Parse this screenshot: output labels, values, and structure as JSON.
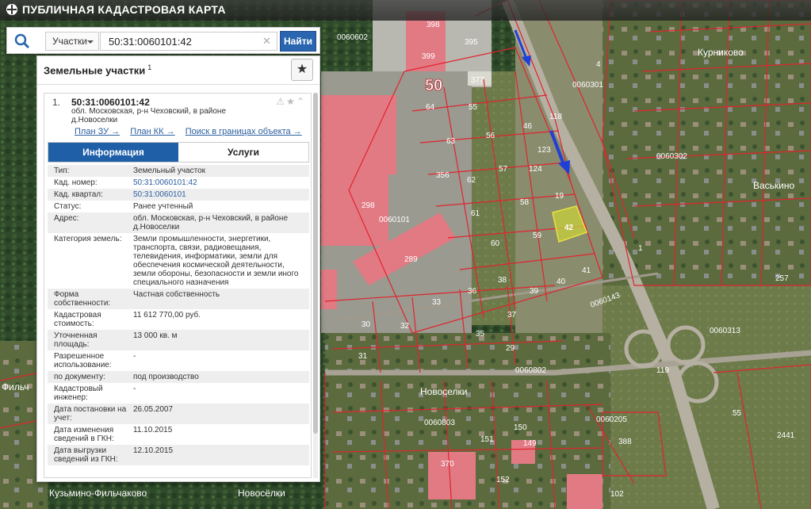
{
  "app": {
    "title": "ПУБЛИЧНАЯ КАДАСТРОВАЯ КАРТА"
  },
  "search": {
    "type_label": "Участки",
    "value": "50:31:0060101:42",
    "button_label": "Найти"
  },
  "panel": {
    "title": "Земельные участки",
    "title_sup": "1",
    "item": {
      "index": "1.",
      "cadnum": "50:31:0060101:42",
      "address": "обл. Московская, р-н Чеховский, в районе д.Новоселки",
      "links": [
        "План ЗУ →",
        "План КК →",
        "Поиск в границах объекта →"
      ]
    },
    "tabs": [
      "Информация",
      "Услуги"
    ],
    "fields": [
      {
        "k": "Тип:",
        "v": "Земельный участок"
      },
      {
        "k": "Кад. номер:",
        "v": "50:31:0060101:42"
      },
      {
        "k": "Кад. квартал:",
        "v": "50:31:0060101"
      },
      {
        "k": "Статус:",
        "v": "Ранее учтенный"
      },
      {
        "k": "Адрес:",
        "v": "обл. Московская, р-н Чеховский, в районе д.Новоселки"
      },
      {
        "k": "Категория земель:",
        "v": "Земли промышленности, энергетики, транспорта, связи, радиовещания, телевидения, информатики, земли для обеспечения космической деятельности, земли обороны, безопасности и земли иного специального назначения"
      },
      {
        "k": "Форма собственности:",
        "v": "Частная собственность"
      },
      {
        "k": "Кадастровая стоимость:",
        "v": "11 612 770,00 руб."
      },
      {
        "k": "Уточненная площадь:",
        "v": "13 000 кв. м"
      },
      {
        "k": "Разрешенное использование:",
        "v": "-"
      },
      {
        "k": "по документу:",
        "v": "под производство"
      },
      {
        "k": "Кадастровый инженер:",
        "v": "-"
      },
      {
        "k": "Дата постановки на учет:",
        "v": "26.05.2007"
      },
      {
        "k": "Дата изменения сведений в ГКН:",
        "v": "11.10.2015"
      },
      {
        "k": "Дата выгрузки сведений из ГКН:",
        "v": "12.10.2015"
      }
    ]
  },
  "map_labels": {
    "districts": [
      "0060602",
      "0060301",
      "0060302",
      "0060101",
      "0060143",
      "0060313",
      "0060802",
      "0060803",
      "0060205"
    ],
    "places": [
      "Курниково",
      "Васькино",
      "Новоселки",
      "Кузьмино-Фильчаково",
      "Новосёлки",
      "Фильч"
    ],
    "region": "50",
    "parcels": [
      "398",
      "399",
      "395",
      "377",
      "64",
      "55",
      "46",
      "118",
      "4",
      "63",
      "56",
      "123",
      "124",
      "57",
      "62",
      "356",
      "298",
      "61",
      "58",
      "19",
      "42",
      "59",
      "60",
      "289",
      "38",
      "40",
      "41",
      "36",
      "33",
      "39",
      "37",
      "30",
      "32",
      "35",
      "29",
      "31",
      "119",
      "257",
      "55",
      "2441",
      "151",
      "152",
      "149",
      "150",
      "388",
      "370",
      "102",
      "1"
    ],
    "selected_parcel": "42"
  }
}
